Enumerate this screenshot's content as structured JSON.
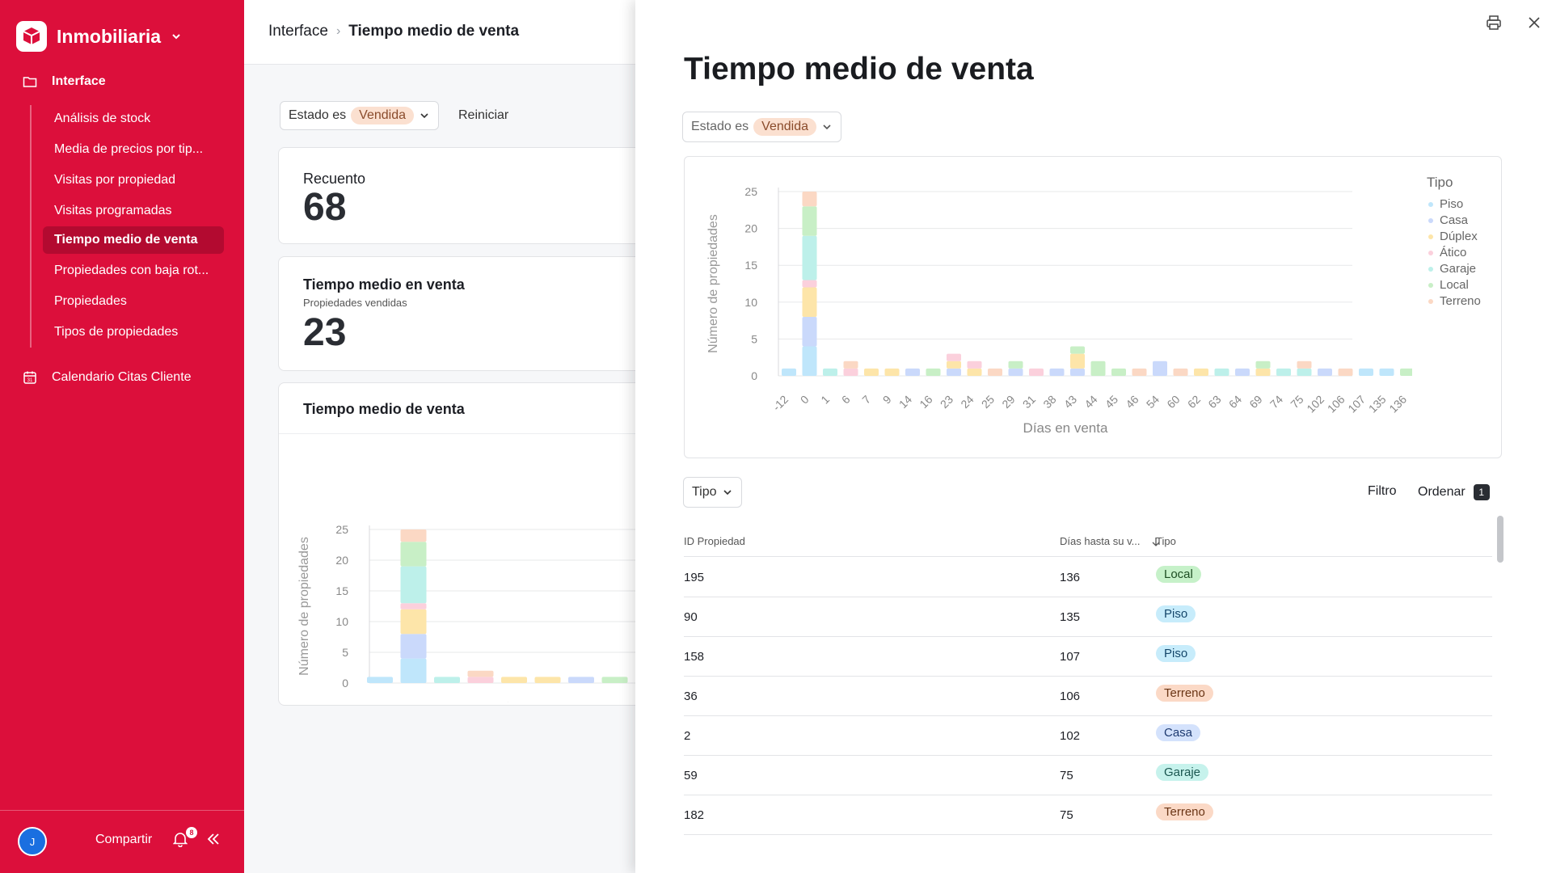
{
  "sidebar": {
    "brand": "Inmobiliaria",
    "group": "Interface",
    "items": [
      {
        "label": "Análisis de stock",
        "active": false
      },
      {
        "label": "Media de precios por tip...",
        "active": false
      },
      {
        "label": "Visitas por propiedad",
        "active": false
      },
      {
        "label": "Visitas programadas",
        "active": false
      },
      {
        "label": "Tiempo medio de venta",
        "active": true
      },
      {
        "label": "Propiedades con baja rot...",
        "active": false
      },
      {
        "label": "Propiedades",
        "active": false
      },
      {
        "label": "Tipos de propiedades",
        "active": false
      }
    ],
    "calendar": "Calendario Citas Cliente",
    "footer": {
      "avatar": "J",
      "share": "Compartir",
      "notifications": "8"
    }
  },
  "breadcrumb": {
    "root": "Interface",
    "current": "Tiempo medio de venta"
  },
  "filters": {
    "label": "Estado es",
    "value": "Vendida",
    "reset": "Reiniciar"
  },
  "cards": {
    "count": {
      "title": "Recuento",
      "value": "68"
    },
    "avg": {
      "title": "Tiempo medio en venta",
      "subtitle": "Propiedades vendidas",
      "value": "23"
    },
    "chart": {
      "title": "Tiempo medio de venta"
    }
  },
  "overlay": {
    "title": "Tiempo medio de venta",
    "tipo_button": "Tipo",
    "filter": "Filtro",
    "sort": "Ordenar",
    "sort_count": "1",
    "legend_title": "Tipo",
    "table": {
      "columns": [
        "ID Propiedad",
        "Días hasta su v...",
        "Tipo"
      ],
      "rows": [
        {
          "id": "195",
          "days": "136",
          "type": "Local"
        },
        {
          "id": "90",
          "days": "135",
          "type": "Piso"
        },
        {
          "id": "158",
          "days": "107",
          "type": "Piso"
        },
        {
          "id": "36",
          "days": "106",
          "type": "Terreno"
        },
        {
          "id": "2",
          "days": "102",
          "type": "Casa"
        },
        {
          "id": "59",
          "days": "75",
          "type": "Garaje"
        },
        {
          "id": "182",
          "days": "75",
          "type": "Terreno"
        }
      ]
    }
  },
  "type_colors": {
    "Piso": "#bfe6fb",
    "Casa": "#cad9fb",
    "Dúplex": "#fde5a9",
    "Ático": "#fbd0dc",
    "Garaje": "#bdf0ea",
    "Local": "#c8efc6",
    "Terreno": "#fbd8c4"
  },
  "tag_styles": {
    "Local": {
      "bg": "#c6f1c9",
      "fg": "#1d4d22"
    },
    "Piso": {
      "bg": "#c7ecfb",
      "fg": "#14466a"
    },
    "Terreno": {
      "bg": "#fbd9c6",
      "fg": "#6a3515"
    },
    "Casa": {
      "bg": "#d4e2fc",
      "fg": "#1e3a70"
    },
    "Garaje": {
      "bg": "#c6f2ec",
      "fg": "#1a5650"
    }
  },
  "chart_data": {
    "type": "bar",
    "title": "",
    "xlabel": "Días en venta",
    "ylabel": "Número de propiedades",
    "ylim": [
      0,
      25
    ],
    "yticks": [
      0,
      5,
      10,
      15,
      20,
      25
    ],
    "legend": "right",
    "categories": [
      "-12",
      "0",
      "1",
      "6",
      "7",
      "9",
      "14",
      "16",
      "23",
      "24",
      "25",
      "29",
      "31",
      "38",
      "43",
      "44",
      "45",
      "46",
      "54",
      "60",
      "62",
      "63",
      "64",
      "69",
      "74",
      "75",
      "102",
      "106",
      "107",
      "135",
      "136"
    ],
    "series": [
      {
        "name": "Piso",
        "values": [
          1,
          4,
          0,
          0,
          0,
          0,
          0,
          0,
          0,
          0,
          0,
          0,
          0,
          0,
          0,
          0,
          0,
          0,
          0,
          0,
          0,
          0,
          0,
          0,
          0,
          0,
          0,
          0,
          1,
          1,
          0
        ]
      },
      {
        "name": "Casa",
        "values": [
          0,
          4,
          0,
          0,
          0,
          0,
          1,
          0,
          1,
          0,
          0,
          1,
          0,
          1,
          1,
          0,
          0,
          0,
          2,
          0,
          0,
          0,
          1,
          0,
          0,
          0,
          1,
          0,
          0,
          0,
          0
        ]
      },
      {
        "name": "Dúplex",
        "values": [
          0,
          4,
          0,
          0,
          1,
          1,
          0,
          0,
          1,
          1,
          0,
          0,
          0,
          0,
          2,
          0,
          0,
          0,
          0,
          0,
          1,
          0,
          0,
          1,
          0,
          0,
          0,
          0,
          0,
          0,
          0
        ]
      },
      {
        "name": "Ático",
        "values": [
          0,
          1,
          0,
          1,
          0,
          0,
          0,
          0,
          1,
          1,
          0,
          0,
          1,
          0,
          0,
          0,
          0,
          0,
          0,
          0,
          0,
          0,
          0,
          0,
          0,
          0,
          0,
          0,
          0,
          0,
          0
        ]
      },
      {
        "name": "Garaje",
        "values": [
          0,
          6,
          1,
          0,
          0,
          0,
          0,
          0,
          0,
          0,
          0,
          0,
          0,
          0,
          0,
          0,
          0,
          0,
          0,
          0,
          0,
          1,
          0,
          0,
          1,
          1,
          0,
          0,
          0,
          0,
          0
        ]
      },
      {
        "name": "Local",
        "values": [
          0,
          4,
          0,
          0,
          0,
          0,
          0,
          1,
          0,
          0,
          0,
          1,
          0,
          0,
          1,
          2,
          1,
          0,
          0,
          0,
          0,
          0,
          0,
          1,
          0,
          0,
          0,
          0,
          0,
          0,
          1
        ]
      },
      {
        "name": "Terreno",
        "values": [
          0,
          2,
          0,
          1,
          0,
          0,
          0,
          0,
          0,
          0,
          1,
          0,
          0,
          0,
          0,
          0,
          0,
          1,
          0,
          1,
          0,
          0,
          0,
          0,
          0,
          1,
          0,
          1,
          0,
          0,
          0
        ]
      }
    ]
  }
}
